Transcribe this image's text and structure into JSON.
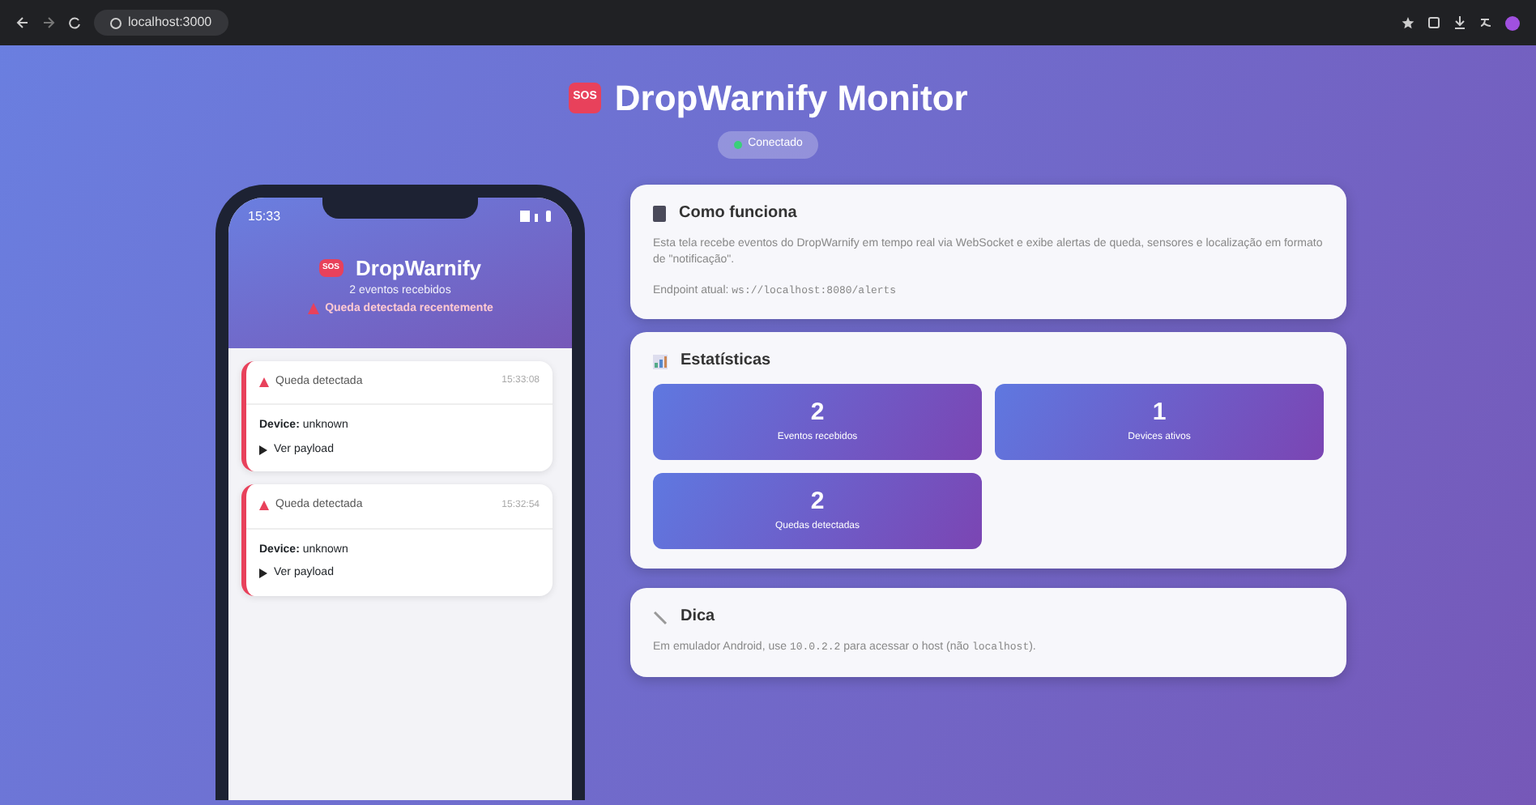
{
  "browser": {
    "address": "localhost:3000"
  },
  "header": {
    "logo": "SOS",
    "title": "DropWarnify Monitor",
    "status": "Conectado",
    "connected": true
  },
  "phone": {
    "time": "15:33",
    "logo": "SOS",
    "app_title": "DropWarnify",
    "subtitle": "2 eventos recebidos",
    "alert": "Queda detectada recentemente",
    "events": [
      {
        "title": "Queda detectada",
        "time": "15:33:08",
        "device_label": "Device:",
        "device": "unknown",
        "payload": "Ver payload"
      },
      {
        "title": "Queda detectada",
        "time": "15:32:54",
        "device_label": "Device:",
        "device": "unknown",
        "payload": "Ver payload"
      }
    ]
  },
  "how": {
    "title": "Como funciona",
    "text": "Esta tela recebe eventos do DropWarnify em tempo real via WebSocket e exibe alertas de queda, sensores e localização em formato de \"notificação\".",
    "endpoint_label": "Endpoint atual:",
    "endpoint": "ws://localhost:8080/alerts"
  },
  "stats": {
    "title": "Estatísticas",
    "items": [
      {
        "value": "2",
        "label": "Eventos recebidos"
      },
      {
        "value": "1",
        "label": "Devices ativos"
      },
      {
        "value": "2",
        "label": "Quedas detectadas"
      }
    ]
  },
  "tip": {
    "title": "Dica",
    "text_before": "Em emulador Android, use",
    "code": "10.0.2.2",
    "text_after": "para acessar o host (não",
    "code2": "localhost",
    "text_end": ")."
  }
}
